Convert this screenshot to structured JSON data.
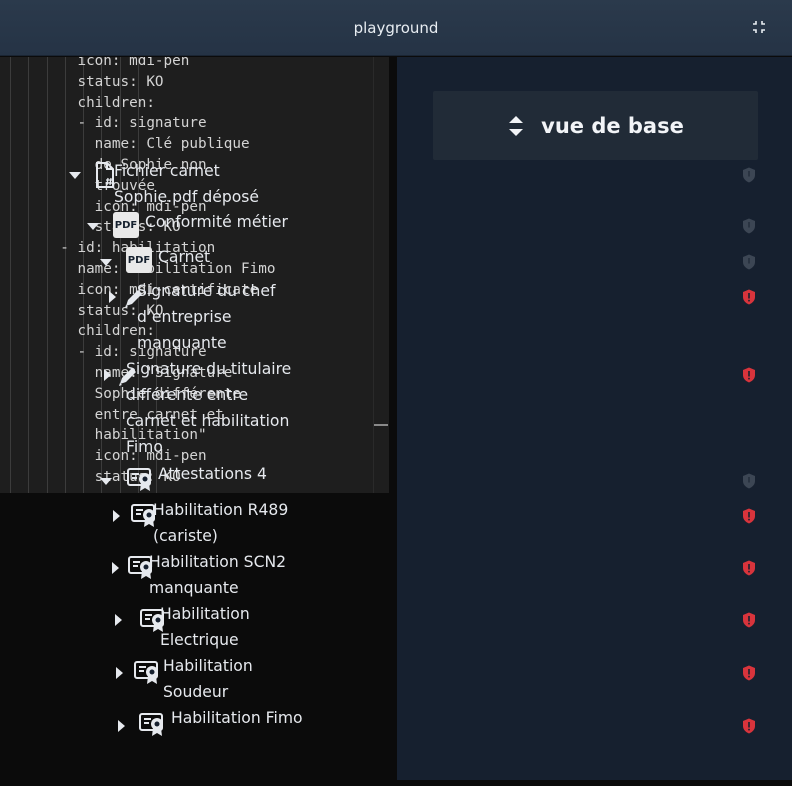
{
  "window": {
    "title": "playground",
    "expand_icon": "expand-icon"
  },
  "editor": {
    "lines": [
      "         icon: mdi-pen",
      "         status: KO",
      "         children:",
      "         - id: signature",
      "           name: Clé publique",
      "           de Sophie non",
      "           trouvée",
      "           icon: mdi-pen",
      "           status: KO",
      "       - id: habilitation",
      "         name: Habilitation Fimo",
      "         icon: mdi-certificate",
      "         status: KO",
      "         children:",
      "         - id: signature",
      "           name: \"Signature",
      "           Sophie différente",
      "           entre carnet et",
      "           habilitation\"",
      "           icon: mdi-pen",
      "           status: KO"
    ]
  },
  "view_selector": {
    "label": "vue de base",
    "icon": "sort-icon"
  },
  "tree": {
    "nodes": [
      {
        "id": "fichier",
        "lines": [
          "Fichier carnet",
          "Sophie.pdf déposé"
        ],
        "icon": "file-code-icon",
        "status": "ok",
        "expanded": true
      },
      {
        "id": "conformite",
        "lines": [
          "Conformité métier"
        ],
        "icon": "pdf-icon",
        "icon_text": "PDF",
        "status": "ok",
        "expanded": true
      },
      {
        "id": "carnet",
        "lines": [
          "Carnet"
        ],
        "icon": "pdf-icon",
        "icon_text": "PDF",
        "status": "ok",
        "expanded": true
      },
      {
        "id": "sig-chef",
        "lines": [
          "Signature du chef",
          "d’entreprise",
          "manquante"
        ],
        "icon": "pen-icon",
        "status": "ko",
        "expanded": false
      },
      {
        "id": "sig-titulaire",
        "lines": [
          "Signature du titulaire",
          "différente entre",
          "carnet et habilitation",
          "Fimo"
        ],
        "icon": "pen-icon",
        "status": "ko",
        "expanded": false
      },
      {
        "id": "attestations",
        "lines": [
          "Attestations 4"
        ],
        "icon": "certificate-icon",
        "status": "ok",
        "expanded": true
      },
      {
        "id": "hab-r489",
        "lines": [
          "Habilitation R489",
          "(cariste)"
        ],
        "icon": "certificate-icon",
        "status": "ko",
        "expanded": false
      },
      {
        "id": "hab-scn2",
        "lines": [
          "Habilitation SCN2",
          "manquante"
        ],
        "icon": "certificate-icon",
        "status": "ko",
        "expanded": false
      },
      {
        "id": "hab-elec",
        "lines": [
          "Habilitation",
          "Electrique"
        ],
        "icon": "certificate-icon",
        "status": "ko",
        "expanded": false
      },
      {
        "id": "hab-soudeur",
        "lines": [
          "Habilitation",
          "Soudeur"
        ],
        "icon": "certificate-icon",
        "status": "ko",
        "expanded": false
      },
      {
        "id": "hab-fimo",
        "lines": [
          "Habilitation Fimo"
        ],
        "icon": "certificate-icon",
        "status": "ko",
        "expanded": false
      }
    ]
  },
  "colors": {
    "status_ko": "#d8343c",
    "status_ok": "#3c4654",
    "panel_bg": "#16202f",
    "editor_bg": "#1e1e1e"
  }
}
